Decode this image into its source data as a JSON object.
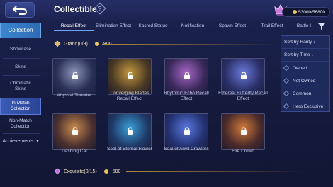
{
  "header": {
    "title": "Collectible",
    "help_symbol": "?",
    "currency_text": "53000/56800"
  },
  "sidebar": {
    "items": [
      {
        "label": "Collection"
      },
      {
        "label": "Showcase"
      },
      {
        "label": "Skins"
      },
      {
        "label": "Chromatic Skins"
      },
      {
        "label": "In-Match Collection"
      },
      {
        "label": "Non-Match Collection"
      },
      {
        "label": "Achievements"
      }
    ]
  },
  "tabs": [
    {
      "label": "Recall Effect"
    },
    {
      "label": "Elimination Effect"
    },
    {
      "label": "Sacred Statue"
    },
    {
      "label": "Notification"
    },
    {
      "label": "Spawn Effect"
    },
    {
      "label": "Trail Effect"
    },
    {
      "label": "Battle I"
    }
  ],
  "dropdown": {
    "sort_rarity": "Sort by Rarity ↓",
    "sort_time": "Sort by Time ↓",
    "options": [
      {
        "label": "Owned"
      },
      {
        "label": "Not Owned"
      },
      {
        "label": "Common"
      },
      {
        "label": "Hero Exclusive"
      }
    ]
  },
  "sections": {
    "grand": {
      "label": "Grand(0/9)",
      "points": "800"
    },
    "exquisite": {
      "label": "Exquisite(0/15)",
      "points": "500"
    }
  },
  "items": [
    {
      "name": "Abyssal Thunder",
      "color": "#8c96b8"
    },
    {
      "name": "Converging Blades Recall Effect",
      "color": "#c4983e"
    },
    {
      "name": "Rhythmic Echo Recall Effect",
      "color": "#a866c8"
    },
    {
      "name": "Ethereal Butterfly Recall Effect",
      "color": "#6a7ad8"
    },
    {
      "name": "Dashing Cat",
      "color": "#c98a4e"
    },
    {
      "name": "Seal of Eternal Flower",
      "color": "#3aa0d8"
    },
    {
      "name": "Seal of Anvil Crawlers",
      "color": "#5a78e0"
    },
    {
      "name": "Fire Crown",
      "color": "#d07a3a"
    }
  ]
}
